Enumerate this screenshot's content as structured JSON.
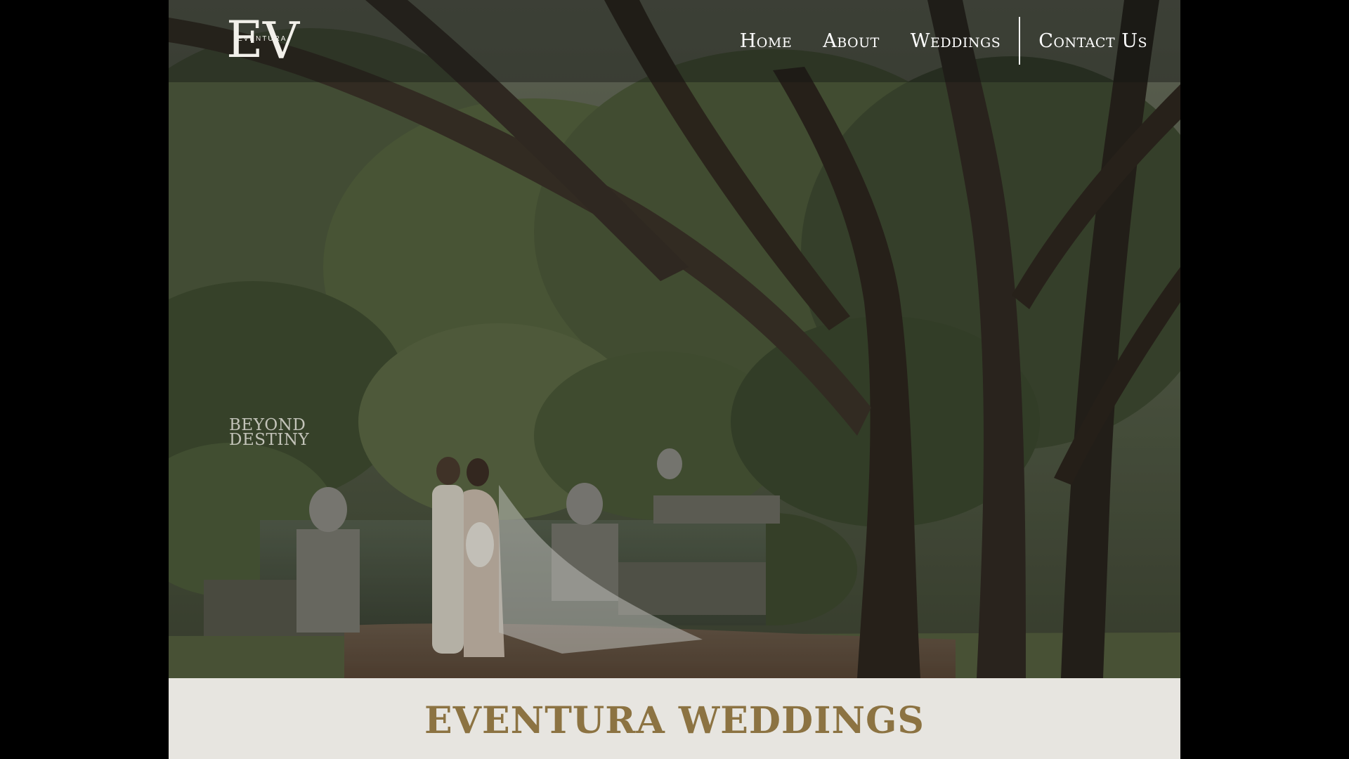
{
  "header": {
    "logo": {
      "letter_left": "E",
      "letter_right": "V",
      "wordmark": "EVENTURA"
    },
    "nav": {
      "items": [
        {
          "label": "Home"
        },
        {
          "label": "About"
        },
        {
          "label": "Weddings"
        },
        {
          "label": "Contact Us"
        }
      ]
    }
  },
  "hero": {
    "watermark_line1": "BEYOND",
    "watermark_line2": "DESTINY"
  },
  "main": {
    "title": "EVENTURA WEDDINGS"
  },
  "colors": {
    "page_background": "#000000",
    "title_band": "#e7e5e0",
    "title_text": "#8c7342",
    "nav_text": "#ffffff"
  }
}
